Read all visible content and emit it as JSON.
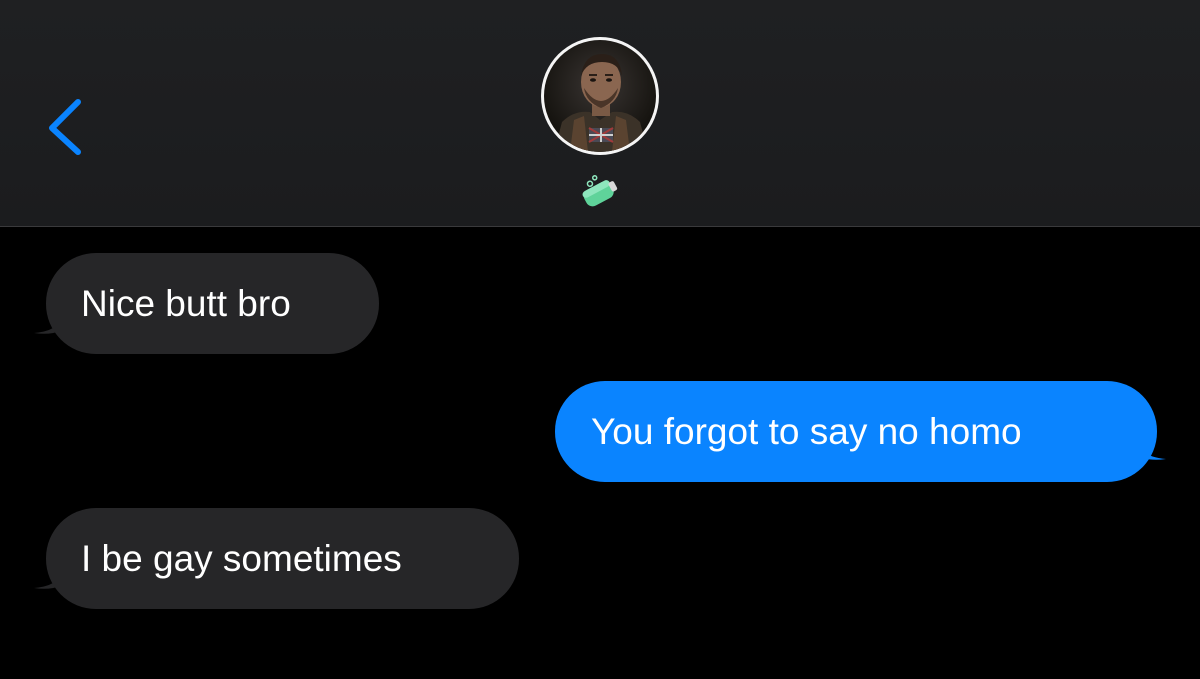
{
  "header": {
    "back_icon": "chevron-left-icon",
    "avatar_icon": "contact-avatar",
    "contact_emoji": "green-potion-bottle-icon",
    "accent_color": "#0a84ff"
  },
  "messages": [
    {
      "direction": "incoming",
      "text": "Nice butt bro"
    },
    {
      "direction": "outgoing",
      "text": "You forgot to say no homo"
    },
    {
      "direction": "incoming",
      "text": "I be gay sometimes"
    }
  ],
  "colors": {
    "incoming_bubble": "#262628",
    "outgoing_bubble": "#0a84ff",
    "background": "#000000",
    "header": "#1e1f21"
  }
}
